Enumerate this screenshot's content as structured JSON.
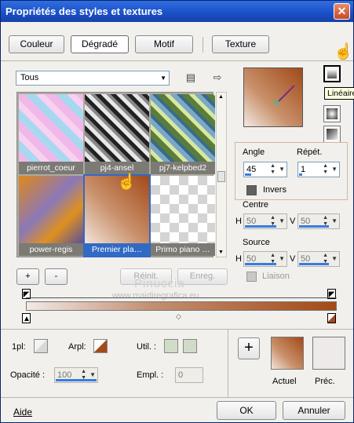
{
  "window": {
    "title": "Propriétés des styles et textures",
    "close": "✕"
  },
  "tabs": [
    {
      "label": "Couleur",
      "active": false
    },
    {
      "label": "Dégradé",
      "active": true
    },
    {
      "label": "Motif",
      "active": false
    },
    {
      "label": "Texture",
      "active": false
    }
  ],
  "gradient_list": {
    "category": "Tous",
    "items": [
      {
        "name": "pierrot_coeur",
        "selected": false
      },
      {
        "name": "pj4-ansel",
        "selected": false
      },
      {
        "name": "pj7-kelpbed2",
        "selected": false
      },
      {
        "name": "power-regis",
        "selected": false
      },
      {
        "name": "Premier pla…",
        "selected": true
      },
      {
        "name": "Primo piano …",
        "selected": false
      }
    ]
  },
  "list_buttons": {
    "add": "+",
    "remove": "-",
    "reset": "Réinit.",
    "save": "Enreg."
  },
  "style_buttons": {
    "tooltip": "Linéaire"
  },
  "settings": {
    "angle_label": "Angle",
    "angle_value": "45",
    "repeat_label": "Répét.",
    "repeat_value": "1",
    "invert_label": "Invers",
    "center_label": "Centre",
    "center_h": "50",
    "center_v": "50",
    "source_label": "Source",
    "source_h": "50",
    "source_v": "50",
    "h": "H",
    "v": "V",
    "link_label": "Liaison"
  },
  "bottom": {
    "1pl": "1pl:",
    "arpl": "Arpl:",
    "util": "Util. :",
    "opacity_label": "Opacité :",
    "opacity_value": "100",
    "empl_label": "Empl. :",
    "empl_value": "0",
    "plus": "+",
    "current": "Actuel",
    "previous": "Préc."
  },
  "footer": {
    "help": "Aide",
    "ok": "OK",
    "cancel": "Annuler"
  },
  "watermark": {
    "line1": "Pinuccia",
    "line2": "www.maidiregrafica.eu"
  },
  "colors": {
    "accent": "#316ac5",
    "gradient_dark": "#a34a18",
    "gradient_light": "#f2e9e6"
  }
}
